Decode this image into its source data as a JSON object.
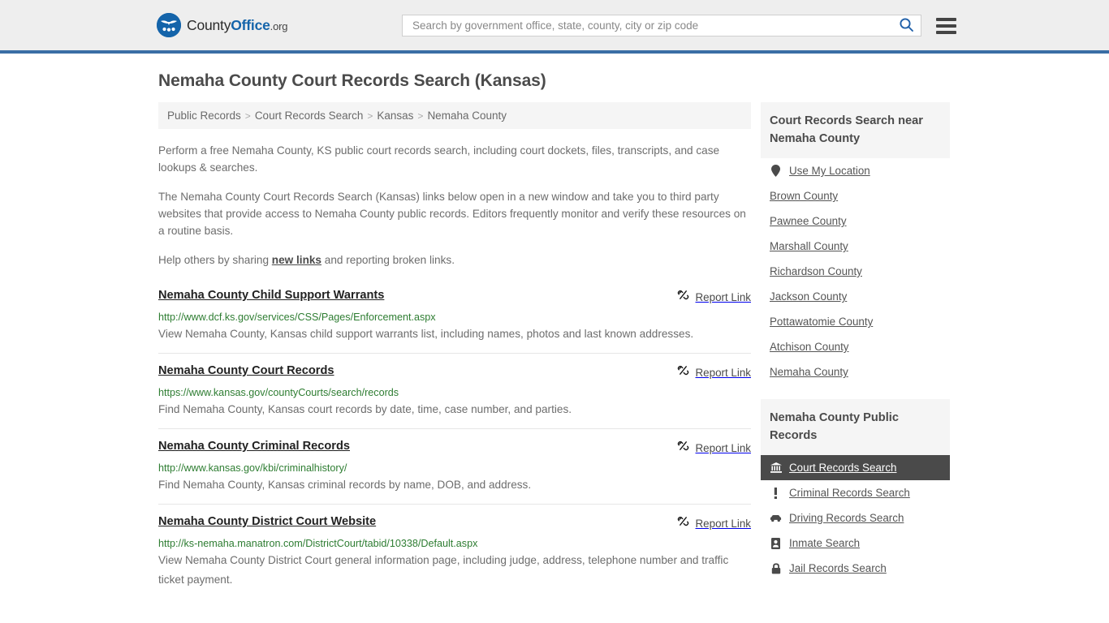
{
  "header": {
    "logo": {
      "part1": "County",
      "part2": "Office",
      "part3": ".org",
      "icon": "eagle-shield-icon"
    },
    "search": {
      "placeholder": "Search by government office, state, county, city or zip code",
      "value": "",
      "button_icon": "search-icon"
    },
    "menu_icon": "hamburger-menu-icon",
    "accent_color": "#3a6ea5",
    "background_color": "#eeeeee"
  },
  "page": {
    "title": "Nemaha County Court Records Search (Kansas)"
  },
  "breadcrumb": {
    "separator": ">",
    "items": [
      {
        "label": "Public Records"
      },
      {
        "label": "Court Records Search"
      },
      {
        "label": "Kansas"
      },
      {
        "label": "Nemaha County"
      }
    ]
  },
  "intro": {
    "paragraph_1": "Perform a free Nemaha County, KS public court records search, including court dockets, files, transcripts, and case lookups & searches.",
    "paragraph_2": "The Nemaha County Court Records Search (Kansas) links below open in a new window and take you to third party websites that provide access to Nemaha County public records. Editors frequently monitor and verify these resources on a routine basis.",
    "paragraph_3_before": "Help others by sharing ",
    "paragraph_3_link": "new links",
    "paragraph_3_after": " and reporting broken links."
  },
  "results": {
    "report_label": "Report Link",
    "report_icon": "broken-chain-icon",
    "items": [
      {
        "title": "Nemaha County Child Support Warrants",
        "url": "http://www.dcf.ks.gov/services/CSS/Pages/Enforcement.aspx",
        "description": "View Nemaha County, Kansas child support warrants list, including names, photos and last known addresses."
      },
      {
        "title": "Nemaha County Court Records",
        "url": "https://www.kansas.gov/countyCourts/search/records",
        "description": "Find Nemaha County, Kansas court records by date, time, case number, and parties."
      },
      {
        "title": "Nemaha County Criminal Records",
        "url": "http://www.kansas.gov/kbi/criminalhistory/",
        "description": "Find Nemaha County, Kansas criminal records by name, DOB, and address."
      },
      {
        "title": "Nemaha County District Court Website",
        "url": "http://ks-nemaha.manatron.com/DistrictCourt/tabid/10338/Default.aspx",
        "description": "View Nemaha County District Court general information page, including judge, address, telephone number and traffic ticket payment."
      }
    ]
  },
  "sidebar": {
    "nearby": {
      "heading": "Court Records Search near Nemaha County",
      "items": [
        {
          "label": "Use My Location",
          "icon": "map-pin-icon"
        },
        {
          "label": "Brown County",
          "icon": ""
        },
        {
          "label": "Pawnee County",
          "icon": ""
        },
        {
          "label": "Marshall County",
          "icon": ""
        },
        {
          "label": "Richardson County",
          "icon": ""
        },
        {
          "label": "Jackson County",
          "icon": ""
        },
        {
          "label": "Pottawatomie County",
          "icon": ""
        },
        {
          "label": "Atchison County",
          "icon": ""
        },
        {
          "label": "Nemaha County",
          "icon": ""
        }
      ]
    },
    "public_records": {
      "heading": "Nemaha County Public Records",
      "active_color": "#4a4a4a",
      "items": [
        {
          "label": "Court Records Search",
          "icon": "courthouse-icon",
          "active": true
        },
        {
          "label": "Criminal Records Search",
          "icon": "exclamation-icon",
          "active": false
        },
        {
          "label": "Driving Records Search",
          "icon": "car-icon",
          "active": false
        },
        {
          "label": "Inmate Search",
          "icon": "id-card-icon",
          "active": false
        },
        {
          "label": "Jail Records Search",
          "icon": "lock-icon",
          "active": false
        }
      ]
    }
  }
}
